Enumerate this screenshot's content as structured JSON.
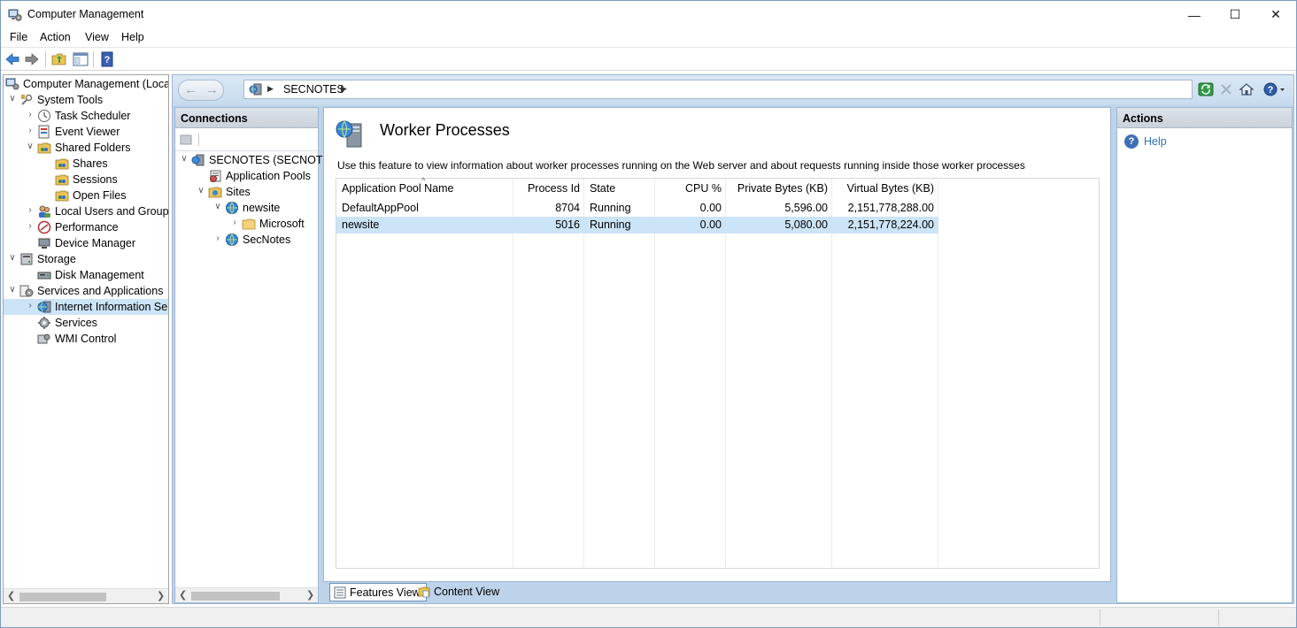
{
  "window": {
    "title": "Computer Management"
  },
  "menu": [
    "File",
    "Action",
    "View",
    "Help"
  ],
  "window_buttons": {
    "minimize": "—",
    "maximize": "☐",
    "close": "✕"
  },
  "mmc_tree": [
    {
      "label": "Computer Management (Local",
      "indent": 0,
      "expander": ""
    },
    {
      "label": "System Tools",
      "indent": 1,
      "expander": "v"
    },
    {
      "label": "Task Scheduler",
      "indent": 2,
      "expander": ">"
    },
    {
      "label": "Event Viewer",
      "indent": 2,
      "expander": ">"
    },
    {
      "label": "Shared Folders",
      "indent": 2,
      "expander": "v"
    },
    {
      "label": "Shares",
      "indent": 3,
      "expander": ""
    },
    {
      "label": "Sessions",
      "indent": 3,
      "expander": ""
    },
    {
      "label": "Open Files",
      "indent": 3,
      "expander": ""
    },
    {
      "label": "Local Users and Groups",
      "indent": 2,
      "expander": ">"
    },
    {
      "label": "Performance",
      "indent": 2,
      "expander": ">"
    },
    {
      "label": "Device Manager",
      "indent": 2,
      "expander": ""
    },
    {
      "label": "Storage",
      "indent": 1,
      "expander": "v"
    },
    {
      "label": "Disk Management",
      "indent": 2,
      "expander": ""
    },
    {
      "label": "Services and Applications",
      "indent": 1,
      "expander": "v"
    },
    {
      "label": "Internet Information Ser",
      "indent": 2,
      "expander": ">",
      "selected": true
    },
    {
      "label": "Services",
      "indent": 2,
      "expander": ""
    },
    {
      "label": "WMI Control",
      "indent": 2,
      "expander": ""
    }
  ],
  "address": {
    "segment": "SECNOTES"
  },
  "connections": {
    "header": "Connections",
    "tree": [
      {
        "label": "SECNOTES (SECNOTES",
        "indent": 0,
        "expander": "v"
      },
      {
        "label": "Application Pools",
        "indent": 1,
        "expander": ""
      },
      {
        "label": "Sites",
        "indent": 1,
        "expander": "v"
      },
      {
        "label": "newsite",
        "indent": 2,
        "expander": "v"
      },
      {
        "label": "Microsoft",
        "indent": 3,
        "expander": ">"
      },
      {
        "label": "SecNotes",
        "indent": 2,
        "expander": ">"
      }
    ]
  },
  "feature": {
    "title": "Worker Processes",
    "description": "Use this feature to view information about worker processes running on the Web server and about requests running inside those worker processes",
    "columns": [
      "Application Pool Name",
      "Process Id",
      "State",
      "CPU %",
      "Private Bytes (KB)",
      "Virtual Bytes (KB)"
    ],
    "sort_indicator": "^",
    "rows": [
      {
        "pool": "DefaultAppPool",
        "pid": "8704",
        "state": "Running",
        "cpu": "0.00",
        "private": "5,596.00",
        "virtual": "2,151,778,288.00"
      },
      {
        "pool": "newsite",
        "pid": "5016",
        "state": "Running",
        "cpu": "0.00",
        "private": "5,080.00",
        "virtual": "2,151,778,224.00",
        "selected": true
      }
    ]
  },
  "tabs": {
    "features": "Features View",
    "content": "Content View"
  },
  "actions": {
    "header": "Actions",
    "help": "Help"
  }
}
